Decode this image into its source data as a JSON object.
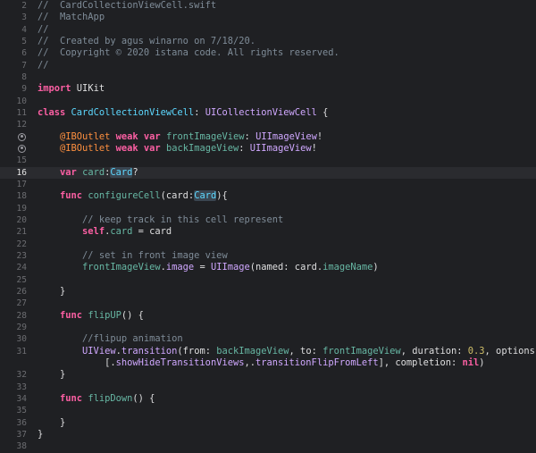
{
  "editor": {
    "file_name": "CardCollectionViewCell.swift",
    "colors": {
      "background": "#1f2023",
      "current_line": "#2a2b2f",
      "comment": "#7f8c98",
      "keyword": "#fc5fa3",
      "type": "#5dd8ff",
      "other_type": "#d0a8ff",
      "property": "#67b7a4",
      "attribute": "#fd8f3f",
      "number": "#d0bf69",
      "plain": "#dfdfe0"
    },
    "current_line_number": 16,
    "lines": [
      {
        "n": "2",
        "tokens": [
          [
            "comment",
            "//  CardCollectionViewCell.swift"
          ]
        ]
      },
      {
        "n": "3",
        "tokens": [
          [
            "comment",
            "//  MatchApp"
          ]
        ]
      },
      {
        "n": "4",
        "tokens": [
          [
            "comment",
            "//"
          ]
        ]
      },
      {
        "n": "5",
        "tokens": [
          [
            "comment",
            "//  Created by agus winarno on 7/18/20."
          ]
        ]
      },
      {
        "n": "6",
        "tokens": [
          [
            "comment",
            "//  Copyright © 2020 istana code. All rights reserved."
          ]
        ]
      },
      {
        "n": "7",
        "tokens": [
          [
            "comment",
            "//"
          ]
        ]
      },
      {
        "n": "8",
        "tokens": []
      },
      {
        "n": "9",
        "tokens": [
          [
            "keyword",
            "import"
          ],
          [
            "plain",
            " UIKit"
          ]
        ]
      },
      {
        "n": "10",
        "tokens": []
      },
      {
        "n": "11",
        "tokens": [
          [
            "keyword",
            "class"
          ],
          [
            "plain",
            " "
          ],
          [
            "typedecl",
            "CardCollectionViewCell"
          ],
          [
            "plain",
            ": "
          ],
          [
            "other-type",
            "UICollectionViewCell"
          ],
          [
            "plain",
            " {"
          ]
        ]
      },
      {
        "n": "12",
        "tokens": []
      },
      {
        "n": "",
        "marker": true,
        "tokens": [
          [
            "plain",
            "    "
          ],
          [
            "attr",
            "@IBOutlet"
          ],
          [
            "plain",
            " "
          ],
          [
            "keyword",
            "weak"
          ],
          [
            "plain",
            " "
          ],
          [
            "keyword",
            "var"
          ],
          [
            "plain",
            " "
          ],
          [
            "func",
            "frontImageView"
          ],
          [
            "plain",
            ": "
          ],
          [
            "other-type",
            "UIImageView"
          ],
          [
            "plain",
            "!"
          ]
        ]
      },
      {
        "n": "",
        "marker": true,
        "tokens": [
          [
            "plain",
            "    "
          ],
          [
            "attr",
            "@IBOutlet"
          ],
          [
            "plain",
            " "
          ],
          [
            "keyword",
            "weak"
          ],
          [
            "plain",
            " "
          ],
          [
            "keyword",
            "var"
          ],
          [
            "plain",
            " "
          ],
          [
            "func",
            "backImageView"
          ],
          [
            "plain",
            ": "
          ],
          [
            "other-type",
            "UIImageView"
          ],
          [
            "plain",
            "!"
          ]
        ]
      },
      {
        "n": "15",
        "tokens": []
      },
      {
        "n": "16",
        "current": true,
        "tokens": [
          [
            "plain",
            "    "
          ],
          [
            "keyword",
            "var"
          ],
          [
            "plain",
            " "
          ],
          [
            "func",
            "card"
          ],
          [
            "plain",
            ":"
          ],
          [
            "type-hl",
            "Card"
          ],
          [
            "plain",
            "?"
          ]
        ]
      },
      {
        "n": "17",
        "tokens": []
      },
      {
        "n": "18",
        "tokens": [
          [
            "plain",
            "    "
          ],
          [
            "keyword",
            "func"
          ],
          [
            "plain",
            " "
          ],
          [
            "func",
            "configureCell"
          ],
          [
            "plain",
            "(card:"
          ],
          [
            "type-hl",
            "Card"
          ],
          [
            "plain",
            "){"
          ]
        ]
      },
      {
        "n": "19",
        "tokens": []
      },
      {
        "n": "20",
        "tokens": [
          [
            "plain",
            "        "
          ],
          [
            "comment",
            "// keep track in this cell represent"
          ]
        ]
      },
      {
        "n": "21",
        "tokens": [
          [
            "plain",
            "        "
          ],
          [
            "keyword",
            "self"
          ],
          [
            "plain",
            "."
          ],
          [
            "prop",
            "card"
          ],
          [
            "plain",
            " = card"
          ]
        ]
      },
      {
        "n": "22",
        "tokens": []
      },
      {
        "n": "23",
        "tokens": [
          [
            "plain",
            "        "
          ],
          [
            "comment",
            "// set in front image view"
          ]
        ]
      },
      {
        "n": "24",
        "tokens": [
          [
            "plain",
            "        "
          ],
          [
            "prop",
            "frontImageView"
          ],
          [
            "plain",
            "."
          ],
          [
            "other-type",
            "image"
          ],
          [
            "plain",
            " = "
          ],
          [
            "other-type",
            "UIImage"
          ],
          [
            "plain",
            "(named: card."
          ],
          [
            "prop",
            "imageName"
          ],
          [
            "plain",
            ")"
          ]
        ]
      },
      {
        "n": "25",
        "tokens": []
      },
      {
        "n": "26",
        "tokens": [
          [
            "plain",
            "    }"
          ]
        ]
      },
      {
        "n": "27",
        "tokens": []
      },
      {
        "n": "28",
        "tokens": [
          [
            "plain",
            "    "
          ],
          [
            "keyword",
            "func"
          ],
          [
            "plain",
            " "
          ],
          [
            "func",
            "flipUP"
          ],
          [
            "plain",
            "() {"
          ]
        ]
      },
      {
        "n": "29",
        "tokens": []
      },
      {
        "n": "30",
        "tokens": [
          [
            "plain",
            "        "
          ],
          [
            "comment",
            "//flipup animation"
          ]
        ]
      },
      {
        "n": "31",
        "tokens": [
          [
            "plain",
            "        "
          ],
          [
            "other-type",
            "UIView"
          ],
          [
            "plain",
            "."
          ],
          [
            "other-type",
            "transition"
          ],
          [
            "plain",
            "(from: "
          ],
          [
            "prop",
            "backImageView"
          ],
          [
            "plain",
            ", to: "
          ],
          [
            "prop",
            "frontImageView"
          ],
          [
            "plain",
            ", duration: "
          ],
          [
            "number",
            "0.3"
          ],
          [
            "plain",
            ", options:"
          ]
        ]
      },
      {
        "n": "",
        "tokens": [
          [
            "plain",
            "            [."
          ],
          [
            "other-type",
            "showHideTransitionViews"
          ],
          [
            "plain",
            ",."
          ],
          [
            "other-type",
            "transitionFlipFromLeft"
          ],
          [
            "plain",
            "], completion: "
          ],
          [
            "keyword",
            "nil"
          ],
          [
            "plain",
            ")"
          ]
        ]
      },
      {
        "n": "32",
        "tokens": [
          [
            "plain",
            "    }"
          ]
        ]
      },
      {
        "n": "33",
        "tokens": []
      },
      {
        "n": "34",
        "tokens": [
          [
            "plain",
            "    "
          ],
          [
            "keyword",
            "func"
          ],
          [
            "plain",
            " "
          ],
          [
            "func",
            "flipDown"
          ],
          [
            "plain",
            "() {"
          ]
        ]
      },
      {
        "n": "35",
        "tokens": []
      },
      {
        "n": "36",
        "tokens": [
          [
            "plain",
            "    }"
          ]
        ]
      },
      {
        "n": "37",
        "tokens": [
          [
            "plain",
            "}"
          ]
        ]
      },
      {
        "n": "38",
        "tokens": []
      }
    ]
  }
}
